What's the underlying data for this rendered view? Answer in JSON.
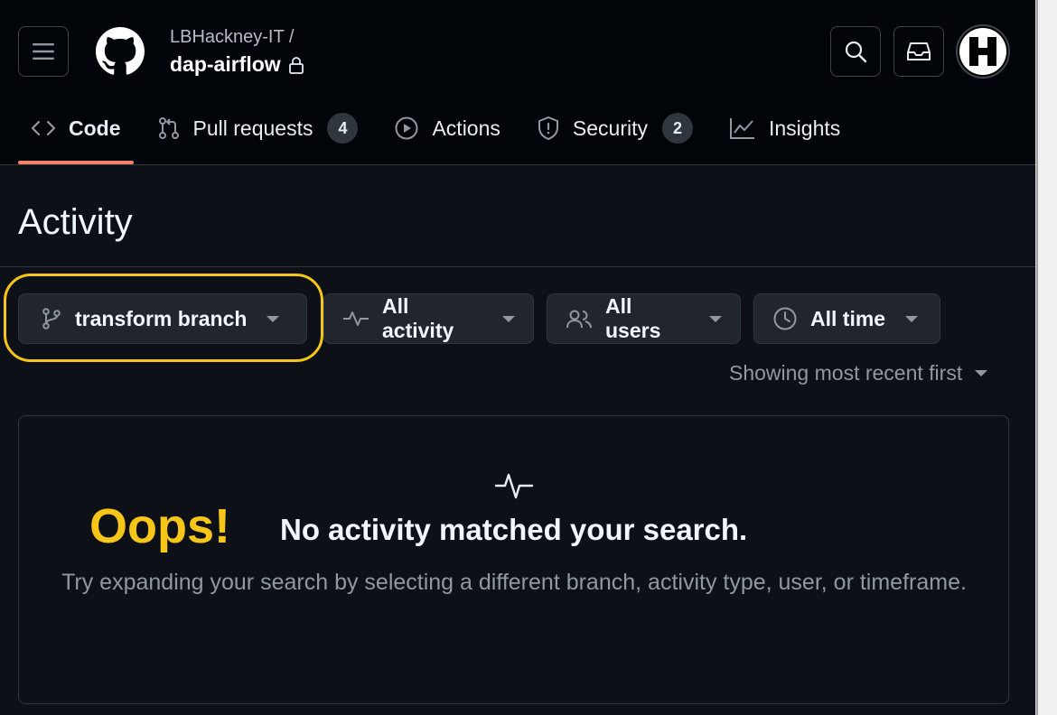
{
  "header": {
    "owner": "LBHackney-IT /",
    "repo": "dap-airflow",
    "icons": [
      "menu-icon",
      "github-logo",
      "lock-icon",
      "search-icon",
      "inbox-icon",
      "avatar"
    ]
  },
  "nav": {
    "tabs": [
      {
        "label": "Code",
        "icon": "code-icon",
        "active": true
      },
      {
        "label": "Pull requests",
        "icon": "pull-request-icon",
        "count": "4"
      },
      {
        "label": "Actions",
        "icon": "play-icon"
      },
      {
        "label": "Security",
        "icon": "shield-icon",
        "count": "2"
      },
      {
        "label": "Insights",
        "icon": "graph-icon"
      }
    ]
  },
  "activity": {
    "title": "Activity",
    "filters": {
      "branch": "transform branch",
      "activity": "All activity",
      "users": "All users",
      "time": "All time"
    },
    "sort": "Showing most recent first",
    "annotation": "Oops!",
    "empty_title": "No activity matched your search.",
    "empty_desc": "Try expanding your search by selecting a different branch, activity type, user, or timeframe."
  },
  "colors": {
    "accent_underline": "#f78166",
    "highlight": "#f5c518",
    "background": "#0d1117",
    "header_bg": "#010409"
  }
}
